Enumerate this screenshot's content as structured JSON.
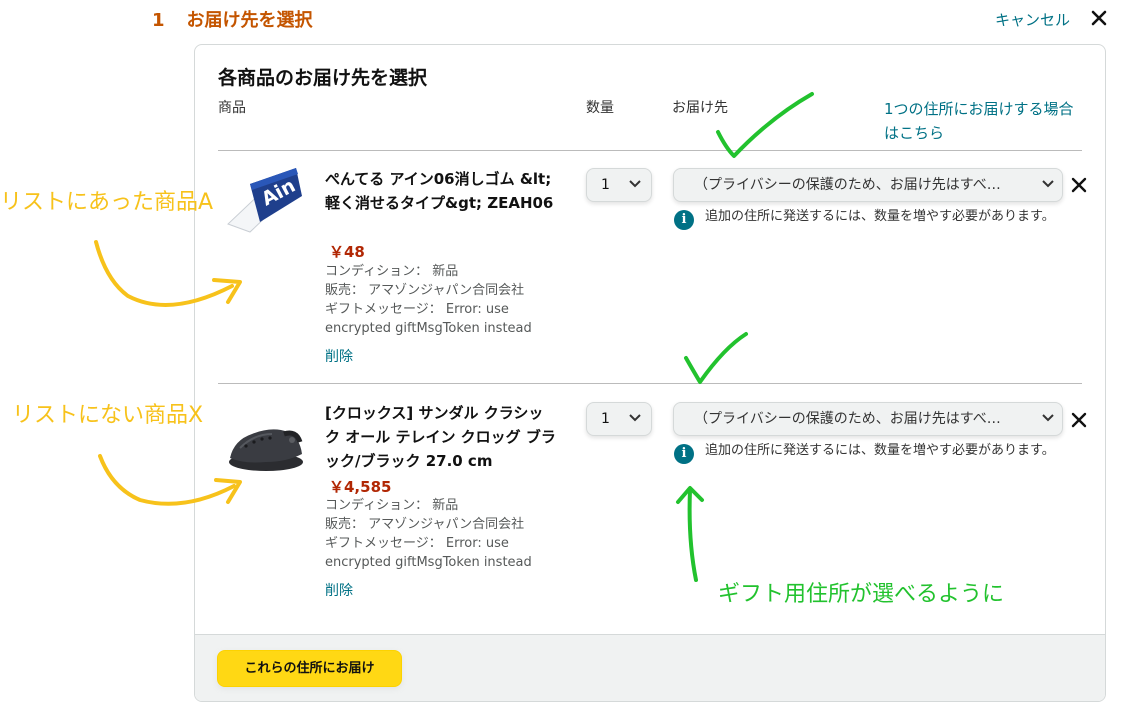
{
  "step": {
    "number": "1",
    "title": "お届け先を選択"
  },
  "cancel": {
    "label": "キャンセル",
    "icon": "close-icon"
  },
  "panel": {
    "title": "各商品のお届け先を選択",
    "columns": {
      "product": "商品",
      "quantity": "数量",
      "destination": "お届け先"
    },
    "single_address_link": "1つの住所にお届けする場合はこちら"
  },
  "items": [
    {
      "title": "ぺんてる アイン06消しゴム &lt;軽く消せるタイプ&gt; ZEAH06",
      "price": "￥48",
      "condition": "コンディション： 新品",
      "seller": "販売： アマゾンジャパン合同会社",
      "gift_message_1": "ギフトメッセージ： Error: use",
      "gift_message_2": "encrypted giftMsgToken instead",
      "delete": "削除",
      "quantity": "1",
      "address": "（プライバシーの保護のため、お届け先はすべ…",
      "info": "追加の住所に発送するには、数量を増やす必要があります。",
      "thumb_brand": "Ain"
    },
    {
      "title": "[クロックス] サンダル クラシック オール テレイン クロッグ ブラック/ブラック 27.0 cm",
      "price": "￥4,585",
      "condition": "コンディション： 新品",
      "seller": "販売： アマゾンジャパン合同会社",
      "gift_message_1": "ギフトメッセージ： Error: use",
      "gift_message_2": "encrypted giftMsgToken instead",
      "delete": "削除",
      "quantity": "1",
      "address": "（プライバシーの保護のため、お届け先はすべ…",
      "info": "追加の住所に発送するには、数量を増やす必要があります。"
    }
  ],
  "submit_button": "これらの住所にお届け",
  "annotations": {
    "item_a": "リストにあった商品A",
    "item_x": "リストにない商品X",
    "gift_address": "ギフト用住所が選べるように"
  },
  "colors": {
    "accent_link": "#007185",
    "price": "#b12704",
    "step_title": "#c45500",
    "button": "#ffd814",
    "annotation_yellow": "#f7c21b",
    "annotation_green": "#22c22e"
  }
}
